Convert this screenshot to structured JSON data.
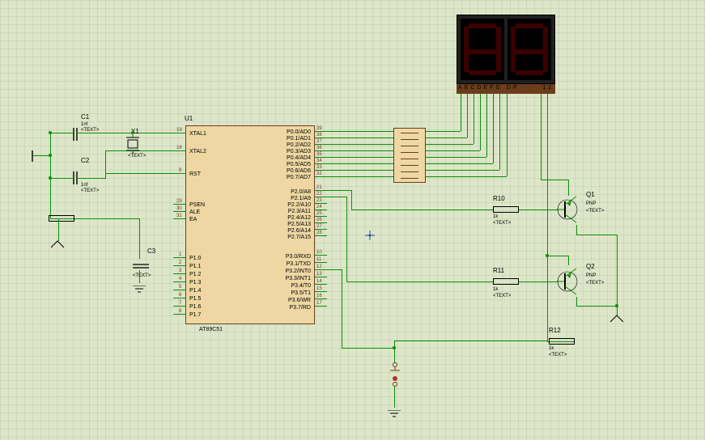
{
  "display": {
    "seg_labels": "ABCDEFG DP",
    "digit_sel_labels": "12"
  },
  "chip": {
    "ref": "U1",
    "part": "AT89C51",
    "left_pins": [
      {
        "num": "19",
        "name": "XTAL1"
      },
      {
        "num": "18",
        "name": "XTAL2"
      },
      {
        "num": "9",
        "name": "RST"
      },
      {
        "num": "29",
        "name": "PSEN"
      },
      {
        "num": "30",
        "name": "ALE"
      },
      {
        "num": "31",
        "name": "EA"
      },
      {
        "num": "1",
        "name": "P1.0"
      },
      {
        "num": "2",
        "name": "P1.1"
      },
      {
        "num": "3",
        "name": "P1.2"
      },
      {
        "num": "4",
        "name": "P1.3"
      },
      {
        "num": "5",
        "name": "P1.4"
      },
      {
        "num": "6",
        "name": "P1.5"
      },
      {
        "num": "7",
        "name": "P1.6"
      },
      {
        "num": "8",
        "name": "P1.7"
      }
    ],
    "right_pins": [
      {
        "num": "39",
        "name": "P0.0/AD0"
      },
      {
        "num": "38",
        "name": "P0.1/AD1"
      },
      {
        "num": "37",
        "name": "P0.2/AD2"
      },
      {
        "num": "36",
        "name": "P0.3/AD3"
      },
      {
        "num": "35",
        "name": "P0.4/AD4"
      },
      {
        "num": "34",
        "name": "P0.5/AD5"
      },
      {
        "num": "33",
        "name": "P0.6/AD6"
      },
      {
        "num": "32",
        "name": "P0.7/AD7"
      },
      {
        "num": "21",
        "name": "P2.0/A8"
      },
      {
        "num": "22",
        "name": "P2.1/A9"
      },
      {
        "num": "23",
        "name": "P2.2/A10"
      },
      {
        "num": "24",
        "name": "P2.3/A11"
      },
      {
        "num": "25",
        "name": "P2.4/A12"
      },
      {
        "num": "26",
        "name": "P2.5/A13"
      },
      {
        "num": "27",
        "name": "P2.6/A14"
      },
      {
        "num": "28",
        "name": "P2.7/A15"
      },
      {
        "num": "10",
        "name": "P3.0/RXD"
      },
      {
        "num": "11",
        "name": "P3.1/TXD"
      },
      {
        "num": "12",
        "name": "P3.2/INT0"
      },
      {
        "num": "13",
        "name": "P3.3/INT1"
      },
      {
        "num": "14",
        "name": "P3.4/T0"
      },
      {
        "num": "15",
        "name": "P3.5/T1"
      },
      {
        "num": "16",
        "name": "P3.6/WR"
      },
      {
        "num": "17",
        "name": "P3.7/RD"
      }
    ]
  },
  "components": {
    "C1": {
      "ref": "C1",
      "val": "1nf",
      "text": "<TEXT>"
    },
    "C2": {
      "ref": "C2",
      "val": "1nf",
      "text": "<TEXT>"
    },
    "C3": {
      "ref": "C3",
      "val": "",
      "text": "<TEXT>"
    },
    "X1": {
      "ref": "X1",
      "text": "<TEXT>"
    },
    "R10": {
      "ref": "R10",
      "val": "1k",
      "text": "<TEXT>"
    },
    "R11": {
      "ref": "R11",
      "val": "1k",
      "text": "<TEXT>"
    },
    "R12": {
      "ref": "R12",
      "val": "1k",
      "text": "<TEXT>"
    },
    "Q1": {
      "ref": "Q1",
      "type": "PNP",
      "text": "<TEXT>"
    },
    "Q2": {
      "ref": "Q2",
      "type": "PNP",
      "text": "<TEXT>"
    }
  }
}
